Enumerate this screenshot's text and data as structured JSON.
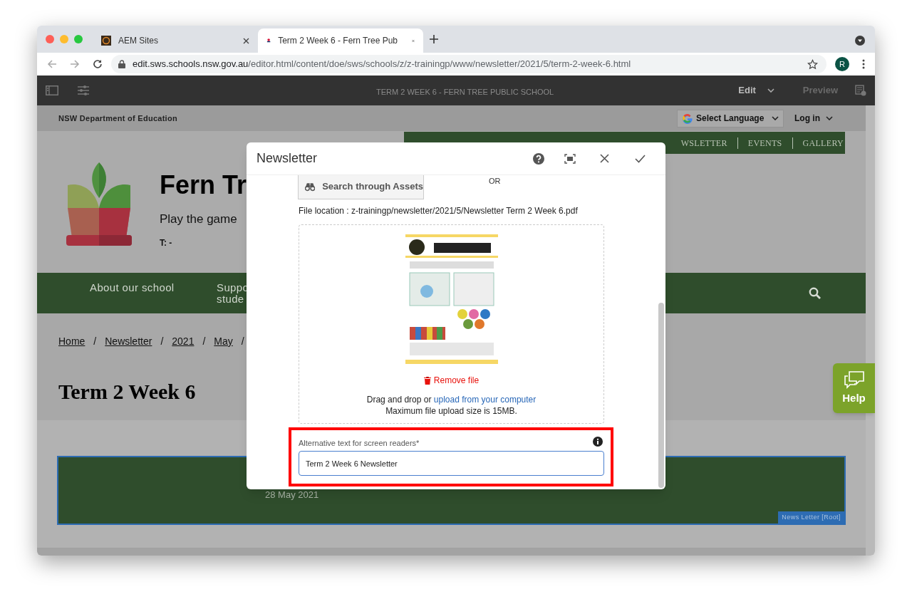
{
  "browser": {
    "tabs": [
      {
        "title": "AEM Sites",
        "selected": false
      },
      {
        "title": "Term 2 Week 6 - Fern Tree Pub",
        "selected": true
      }
    ],
    "url_host": "edit.sws.schools.nsw.gov.au",
    "url_path": "/editor.html/content/doe/sws/schools/z/z-trainingp/www/newsletter/2021/5/term-2-week-6.html",
    "profile_initial": "R"
  },
  "editor_toolbar": {
    "title": "TERM 2 WEEK 6 - FERN TREE PUBLIC SCHOOL",
    "mode": "Edit",
    "preview": "Preview"
  },
  "site": {
    "department": "NSW Department of Education",
    "language": "Select Language",
    "login": "Log in",
    "top_nav": [
      "WSLETTER",
      "EVENTS",
      "GALLERY"
    ],
    "school_name": "Fern Tr",
    "motto": "Play the game",
    "phone": "T: -",
    "main_nav": [
      {
        "lines": [
          "About our school"
        ]
      },
      {
        "lines": [
          "Suppo",
          "stude"
        ]
      }
    ],
    "breadcrumb": [
      "Home",
      "Newsletter",
      "2021",
      "May"
    ],
    "breadcrumb_separator": "/",
    "page_title": "Term 2 Week 6",
    "date": "28 May 2021",
    "component_label": "News Letter [Root]",
    "help": "Help"
  },
  "dialog": {
    "title": "Newsletter",
    "search_button": "Search through Assets",
    "or": "OR",
    "file_location": "File location : z-trainingp/newsletter/2021/5/Newsletter Term 2 Week 6.pdf",
    "remove": "Remove file",
    "drop_text": "Drag and drop or",
    "upload_link": "upload from your computer",
    "max_size": "Maximum file upload size is 15MB.",
    "alt_label": "Alternative text for screen readers*",
    "alt_value": "Term 2 Week 6 Newsletter"
  }
}
